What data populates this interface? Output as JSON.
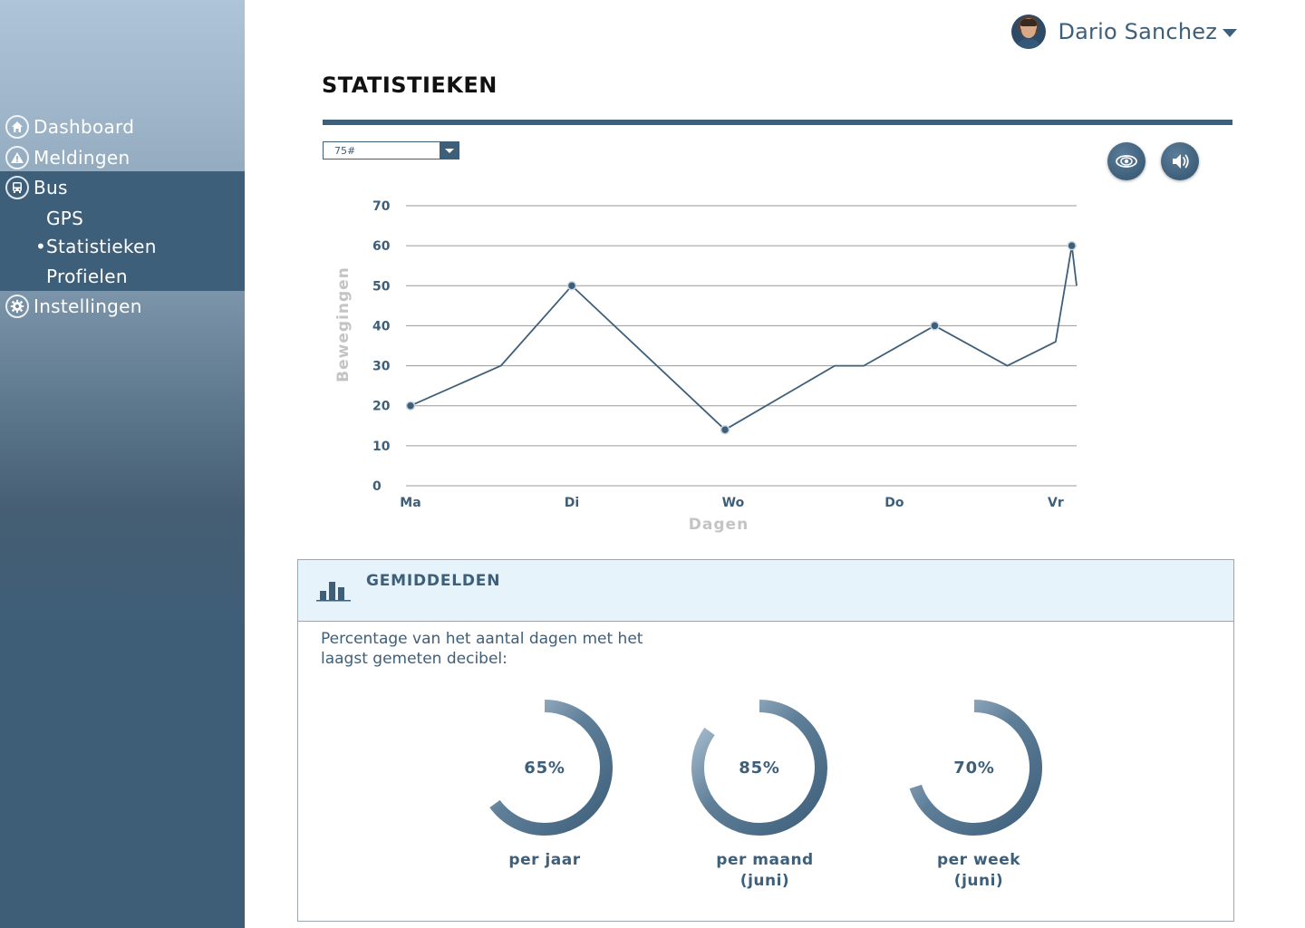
{
  "user": {
    "name": "Dario Sanchez"
  },
  "sidebar": {
    "items": [
      {
        "label": "Dashboard",
        "icon": "home-icon"
      },
      {
        "label": "Meldingen",
        "icon": "alert-icon"
      },
      {
        "label": "Bus",
        "icon": "bus-icon"
      },
      {
        "label": "Instellingen",
        "icon": "gear-icon"
      }
    ],
    "subitems": [
      {
        "label": "GPS"
      },
      {
        "label": "Statistieken",
        "active": true
      },
      {
        "label": "Profielen"
      }
    ]
  },
  "page": {
    "title": "STATISTIEKEN"
  },
  "filter": {
    "selected": "75#"
  },
  "buttons": {
    "view": "eye-icon",
    "sound": "speaker-icon"
  },
  "chart_data": {
    "type": "line",
    "title": "",
    "xlabel": "Dagen",
    "ylabel": "Bewegingen",
    "ylim": [
      0,
      70
    ],
    "yticks": [
      0,
      10,
      20,
      30,
      40,
      50,
      60,
      70
    ],
    "xlim": [
      0,
      4.13
    ],
    "categories": [
      "Ma",
      "Di",
      "Wo",
      "Do",
      "Vr"
    ],
    "series": [
      {
        "x": [
          0,
          0.56,
          1.0,
          1.95,
          2.63,
          2.81,
          3.25,
          3.7,
          4.0,
          4.1,
          4.13
        ],
        "y": [
          20,
          30,
          50,
          14,
          30,
          30,
          40,
          30,
          36,
          60,
          50
        ],
        "markers": [
          0,
          2,
          3,
          6,
          9
        ]
      }
    ],
    "color": "#3e5f7a",
    "grid": true
  },
  "averages": {
    "title": "GEMIDDELDEN",
    "description": "Percentage van het aantal dagen met het laagst gemeten decibel:",
    "items": [
      {
        "value": 0.65,
        "label_value": "65%",
        "label": "per jaar"
      },
      {
        "value": 0.85,
        "label_value": "85%",
        "label": "per  maand\n(juni)"
      },
      {
        "value": 0.7,
        "label_value": "70%",
        "label": "per week\n(juni)"
      }
    ]
  }
}
